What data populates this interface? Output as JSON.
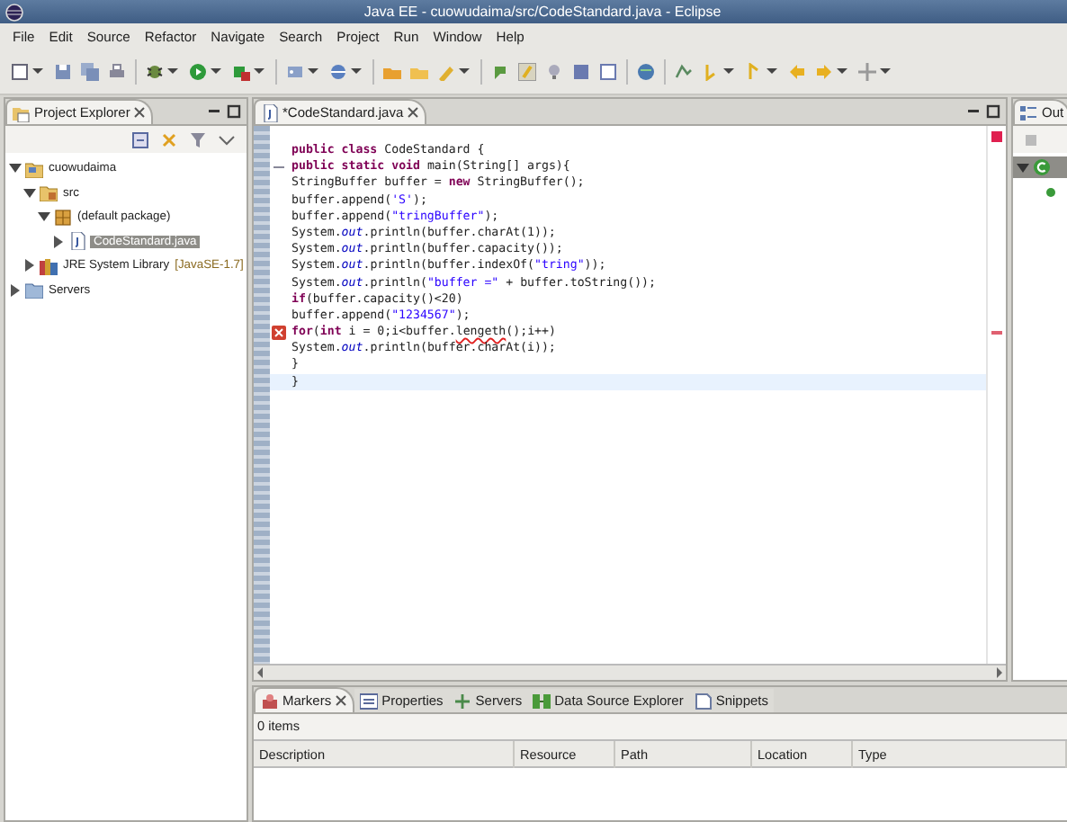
{
  "window": {
    "title": "Java EE - cuowudaima/src/CodeStandard.java - Eclipse"
  },
  "menu": [
    "File",
    "Edit",
    "Source",
    "Refactor",
    "Navigate",
    "Search",
    "Project",
    "Run",
    "Window",
    "Help"
  ],
  "project_explorer": {
    "tab": "Project Explorer",
    "tree": [
      {
        "label": "cuowudaima",
        "kind": "project",
        "expanded": true,
        "selected": false,
        "children": [
          {
            "label": "src",
            "kind": "folder",
            "expanded": true,
            "selected": false,
            "children": [
              {
                "label": "(default package)",
                "kind": "package",
                "expanded": true,
                "selected": false,
                "children": [
                  {
                    "label": "CodeStandard.java",
                    "kind": "java-file",
                    "expanded": false,
                    "selected": true
                  }
                ]
              }
            ]
          },
          {
            "label": "JRE System Library",
            "decoration": "[JavaSE-1.7]",
            "kind": "library",
            "expanded": false,
            "selected": false
          }
        ]
      },
      {
        "label": "Servers",
        "kind": "servers",
        "expanded": false,
        "selected": false
      }
    ]
  },
  "editor": {
    "tab": "*CodeStandard.java",
    "lines": [
      {
        "error": false,
        "current": false,
        "foldable": false,
        "tokens": [
          {
            "kind": "keyword",
            "text": "public "
          },
          {
            "kind": "keyword",
            "text": "class"
          },
          {
            "kind": "plain",
            "text": " CodeStandard {"
          }
        ]
      },
      {
        "error": false,
        "current": false,
        "foldable": true,
        "tokens": [
          {
            "kind": "keyword",
            "text": "public "
          },
          {
            "kind": "keyword",
            "text": "static "
          },
          {
            "kind": "keyword",
            "text": "void"
          },
          {
            "kind": "plain",
            "text": " main(String[] args){"
          }
        ]
      },
      {
        "error": false,
        "current": false,
        "foldable": false,
        "tokens": [
          {
            "kind": "plain",
            "text": "StringBuffer buffer = "
          },
          {
            "kind": "keyword",
            "text": "new"
          },
          {
            "kind": "plain",
            "text": " StringBuffer();"
          }
        ]
      },
      {
        "error": false,
        "current": false,
        "foldable": false,
        "tokens": [
          {
            "kind": "plain",
            "text": "buffer.append("
          },
          {
            "kind": "string",
            "text": "'S'"
          },
          {
            "kind": "plain",
            "text": ");"
          }
        ]
      },
      {
        "error": false,
        "current": false,
        "foldable": false,
        "tokens": [
          {
            "kind": "plain",
            "text": "buffer.append("
          },
          {
            "kind": "string",
            "text": "\"tringBuffer\""
          },
          {
            "kind": "plain",
            "text": ");"
          }
        ]
      },
      {
        "error": false,
        "current": false,
        "foldable": false,
        "tokens": [
          {
            "kind": "plain",
            "text": "System."
          },
          {
            "kind": "field",
            "text": "out"
          },
          {
            "kind": "plain",
            "text": ".println(buffer.charAt(1));"
          }
        ]
      },
      {
        "error": false,
        "current": false,
        "foldable": false,
        "tokens": [
          {
            "kind": "plain",
            "text": "System."
          },
          {
            "kind": "field",
            "text": "out"
          },
          {
            "kind": "plain",
            "text": ".println(buffer.capacity());"
          }
        ]
      },
      {
        "error": false,
        "current": false,
        "foldable": false,
        "tokens": [
          {
            "kind": "plain",
            "text": "System."
          },
          {
            "kind": "field",
            "text": "out"
          },
          {
            "kind": "plain",
            "text": ".println(buffer.indexOf("
          },
          {
            "kind": "string",
            "text": "\"tring\""
          },
          {
            "kind": "plain",
            "text": "));"
          }
        ]
      },
      {
        "error": false,
        "current": false,
        "foldable": false,
        "tokens": [
          {
            "kind": "plain",
            "text": "System."
          },
          {
            "kind": "field",
            "text": "out"
          },
          {
            "kind": "plain",
            "text": ".println("
          },
          {
            "kind": "string",
            "text": "\"buffer =\""
          },
          {
            "kind": "plain",
            "text": " + buffer.toString());"
          }
        ]
      },
      {
        "error": false,
        "current": false,
        "foldable": false,
        "tokens": [
          {
            "kind": "keyword",
            "text": "if"
          },
          {
            "kind": "plain",
            "text": "(buffer.capacity()<20)"
          }
        ]
      },
      {
        "error": false,
        "current": false,
        "foldable": false,
        "tokens": [
          {
            "kind": "plain",
            "text": "buffer.append("
          },
          {
            "kind": "string",
            "text": "\"1234567\""
          },
          {
            "kind": "plain",
            "text": ");"
          }
        ]
      },
      {
        "error": true,
        "current": false,
        "foldable": false,
        "tokens": [
          {
            "kind": "keyword",
            "text": "for"
          },
          {
            "kind": "plain",
            "text": "("
          },
          {
            "kind": "keyword",
            "text": "int"
          },
          {
            "kind": "plain",
            "text": " i = 0;i<buffer."
          },
          {
            "kind": "error",
            "text": "lengeth"
          },
          {
            "kind": "plain",
            "text": "();i++)"
          }
        ]
      },
      {
        "error": false,
        "current": false,
        "foldable": false,
        "tokens": [
          {
            "kind": "plain",
            "text": "System."
          },
          {
            "kind": "field",
            "text": "out"
          },
          {
            "kind": "plain",
            "text": ".println(buffer.charAt(i));"
          }
        ]
      },
      {
        "error": false,
        "current": false,
        "foldable": false,
        "tokens": [
          {
            "kind": "plain",
            "text": "}"
          }
        ]
      },
      {
        "error": false,
        "current": true,
        "foldable": false,
        "tokens": [
          {
            "kind": "plain",
            "text": "}"
          }
        ]
      }
    ]
  },
  "outline": {
    "tab": "Out"
  },
  "bottom_panel": {
    "tabs": [
      {
        "label": "Markers",
        "kind": "markers",
        "selected": true
      },
      {
        "label": "Properties",
        "kind": "properties",
        "selected": false
      },
      {
        "label": "Servers",
        "kind": "servers",
        "selected": false
      },
      {
        "label": "Data Source Explorer",
        "kind": "datasource",
        "selected": false
      },
      {
        "label": "Snippets",
        "kind": "snippets",
        "selected": false
      }
    ],
    "status": "0 items",
    "columns": [
      "Description",
      "Resource",
      "Path",
      "Location",
      "Type"
    ]
  }
}
